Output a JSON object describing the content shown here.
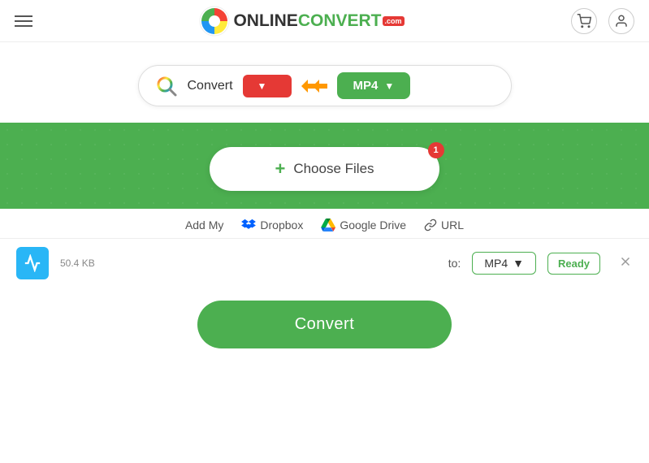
{
  "header": {
    "menu_icon": "≡",
    "logo_text_black": "ONLINE",
    "logo_text_green": "CONVERT",
    "logo_com": ".com",
    "cart_icon": "🛒",
    "user_icon": "👤"
  },
  "search_bar": {
    "convert_label": "Convert",
    "from_placeholder": "",
    "arrow": ">>>",
    "to_format": "MP4"
  },
  "drop_zone": {
    "choose_files_label": "Choose Files",
    "badge_count": "1",
    "add_my_label": "Add My",
    "dropbox_label": "Dropbox",
    "google_drive_label": "Google Drive",
    "url_label": "URL"
  },
  "file_row": {
    "file_size": "50.4 KB",
    "to_label": "to:",
    "format": "MP4",
    "status": "Ready"
  },
  "convert_button": {
    "label": "Convert"
  }
}
